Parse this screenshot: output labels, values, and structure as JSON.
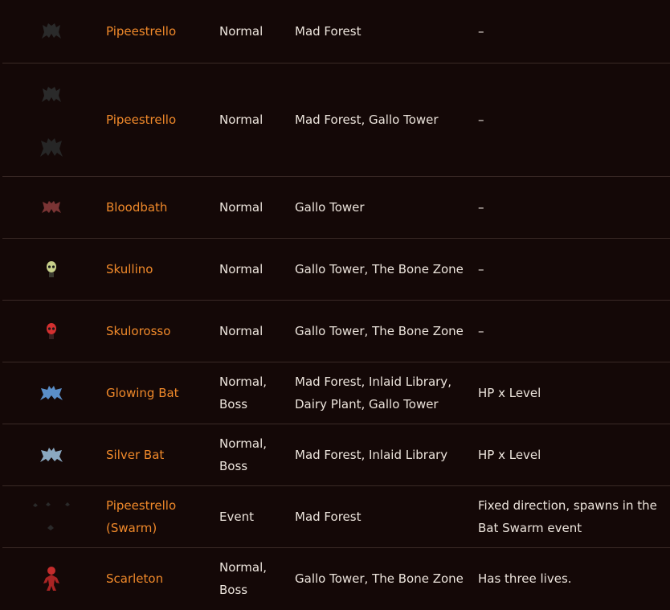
{
  "enemies": [
    {
      "name": "Pipeestrello",
      "type": "Normal",
      "stages": "Mad Forest",
      "notes": "–",
      "sprites": [
        {
          "icon": "bat-icon",
          "color": "#2a2a2a"
        }
      ]
    },
    {
      "name": "Pipeestrello",
      "type": "Normal",
      "stages": "Mad Forest, Gallo Tower",
      "notes": "–",
      "sprites": [
        {
          "icon": "bat-icon",
          "color": "#2a2a2a"
        },
        {
          "icon": "bat-icon",
          "color": "#262626"
        }
      ]
    },
    {
      "name": "Bloodbath",
      "type": "Normal",
      "stages": "Gallo Tower",
      "notes": "–",
      "sprites": [
        {
          "icon": "bat-icon",
          "color": "#7a3434"
        }
      ]
    },
    {
      "name": "Skullino",
      "type": "Normal",
      "stages": "Gallo Tower, The Bone Zone",
      "notes": "–",
      "sprites": [
        {
          "icon": "skull-icon",
          "color": "#c8d08a"
        }
      ]
    },
    {
      "name": "Skulorosso",
      "type": "Normal",
      "stages": "Gallo Tower, The Bone Zone",
      "notes": "–",
      "sprites": [
        {
          "icon": "skull-icon",
          "color": "#d43030"
        }
      ]
    },
    {
      "name": "Glowing Bat",
      "type": "Normal, Boss",
      "stages": "Mad Forest, Inlaid Library, Dairy Plant, Gallo Tower",
      "notes": "HP x Level",
      "sprites": [
        {
          "icon": "bat-icon",
          "color": "#5a8ec8"
        }
      ]
    },
    {
      "name": "Silver Bat",
      "type": "Normal, Boss",
      "stages": "Mad Forest, Inlaid Library",
      "notes": "HP x Level",
      "sprites": [
        {
          "icon": "bat-icon",
          "color": "#8aa8c0"
        }
      ]
    },
    {
      "name": "Pipeestrello (Swarm)",
      "type": "Event",
      "stages": "Mad Forest",
      "notes": "Fixed direction, spawns in the Bat Swarm event",
      "sprites": [
        {
          "icon": "bat-swarm-icon",
          "color": "#2a2a2a"
        }
      ]
    },
    {
      "name": "Scarleton",
      "type": "Normal, Boss",
      "stages": "Gallo Tower, The Bone Zone",
      "notes": "Has three lives.",
      "sprites": [
        {
          "icon": "skeleton-icon",
          "color": "#c42c2c"
        }
      ]
    }
  ]
}
